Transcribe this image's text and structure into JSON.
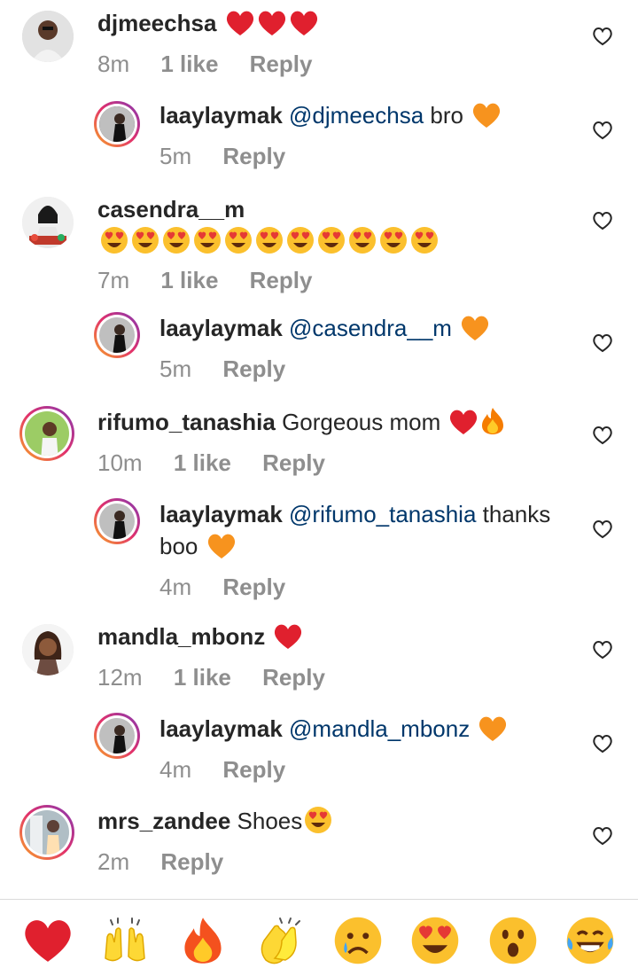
{
  "comments": [
    {
      "username": "djmeechsa",
      "text": "",
      "emojis": [
        "red-heart",
        "red-heart",
        "red-heart"
      ],
      "time": "8m",
      "likes": "1 like",
      "reply": "Reply",
      "replies": [
        {
          "username": "laaylaymak",
          "mention": "@djmeechsa",
          "text": " bro",
          "emojis": [
            "orange-heart"
          ],
          "time": "5m",
          "reply": "Reply"
        }
      ]
    },
    {
      "username": "casendra__m",
      "text": "",
      "emojis": [
        "heart-eyes",
        "heart-eyes",
        "heart-eyes",
        "heart-eyes",
        "heart-eyes",
        "heart-eyes",
        "heart-eyes",
        "heart-eyes",
        "heart-eyes",
        "heart-eyes",
        "heart-eyes"
      ],
      "time": "7m",
      "likes": "1 like",
      "reply": "Reply",
      "replies": [
        {
          "username": "laaylaymak",
          "mention": "@casendra__m",
          "text": "",
          "emojis": [
            "orange-heart"
          ],
          "time": "5m",
          "reply": "Reply"
        }
      ]
    },
    {
      "username": "rifumo_tanashia",
      "text": "Gorgeous mom",
      "emojis": [
        "red-heart",
        "fire"
      ],
      "time": "10m",
      "likes": "1 like",
      "reply": "Reply",
      "replies": [
        {
          "username": "laaylaymak",
          "mention": "@rifumo_tanashia",
          "text": " thanks",
          "text2": "boo",
          "emojis": [
            "orange-heart"
          ],
          "time": "4m",
          "reply": "Reply"
        }
      ]
    },
    {
      "username": "mandla_mbonz",
      "text": "",
      "emojis": [
        "red-heart"
      ],
      "time": "12m",
      "likes": "1 like",
      "reply": "Reply",
      "replies": [
        {
          "username": "laaylaymak",
          "mention": "@mandla_mbonz",
          "text": "",
          "emojis": [
            "orange-heart"
          ],
          "time": "4m",
          "reply": "Reply"
        }
      ]
    },
    {
      "username": "mrs_zandee",
      "text": "Shoes",
      "emojis": [
        "heart-eyes"
      ],
      "time": "2m",
      "reply": "Reply"
    }
  ],
  "reaction_bar": [
    "red-heart",
    "raising-hands",
    "fire",
    "clapping-hands",
    "crying-face",
    "heart-eyes",
    "surprised-face",
    "tears-of-joy"
  ],
  "colors": {
    "text": "#262626",
    "secondary": "#8e8e8e",
    "mention": "#00376b",
    "red_heart": "#e0202e",
    "orange_heart": "#f7931e"
  }
}
